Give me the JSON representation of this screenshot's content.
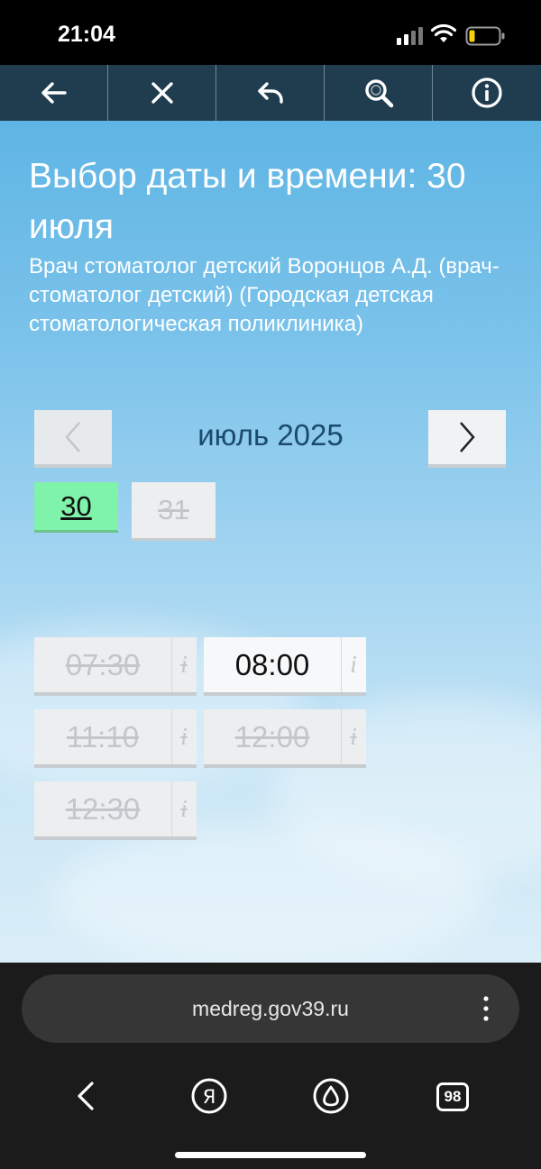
{
  "status": {
    "time": "21:04",
    "icons": [
      "signal-icon",
      "wifi-icon",
      "battery-icon"
    ]
  },
  "toolbar": {
    "items": [
      {
        "icon": "arrow-left-icon"
      },
      {
        "icon": "close-icon"
      },
      {
        "icon": "undo-arrow-icon"
      },
      {
        "icon": "search-icon"
      },
      {
        "icon": "info-icon"
      }
    ]
  },
  "page": {
    "title": "Выбор даты и времени: 30 июля",
    "doctor": "Врач стоматолог детский Воронцов А.Д. (врач-стоматолог детский) (Городская детская стоматологическая поликлиника)"
  },
  "calendar": {
    "month_label": "июль 2025",
    "days": [
      {
        "label": "30",
        "selected": true,
        "available": true
      },
      {
        "label": "31",
        "selected": false,
        "available": false
      }
    ]
  },
  "slots": [
    {
      "time": "07:30",
      "info": "i",
      "available": false
    },
    {
      "time": "08:00",
      "info": "i",
      "available": true
    },
    {
      "time": "11:10",
      "info": "i",
      "available": false
    },
    {
      "time": "12:00",
      "info": "i",
      "available": false
    },
    {
      "time": "12:30",
      "info": "i",
      "available": false
    }
  ],
  "browser": {
    "url": "medreg.gov39.ru",
    "tabs_count": "98",
    "nav_icons": [
      "back-icon",
      "yandex-icon",
      "alice-icon",
      "tabs-icon"
    ]
  },
  "colors": {
    "toolbar_bg": "#1f3d4f",
    "selected_day": "#7ff3a9",
    "month_label": "#1a4a6e"
  }
}
